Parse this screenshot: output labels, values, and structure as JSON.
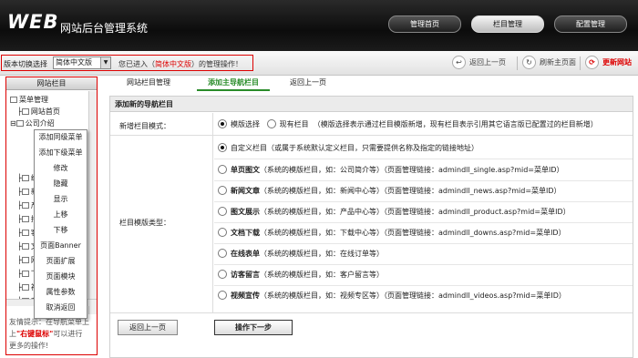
{
  "header": {
    "logo_web": "WEB",
    "logo_title": "网站后台管理系统",
    "nav": [
      {
        "label": "管理首页",
        "active": false
      },
      {
        "label": "栏目管理",
        "active": true
      },
      {
        "label": "配置管理",
        "active": false
      }
    ]
  },
  "toolbar": {
    "version_label": "版本切换选择",
    "version_selected": "简体中文版",
    "message_prefix": "您已进入（",
    "message_highlight": "简体中文版",
    "message_suffix": "）的管理操作！",
    "back_label": "返回上一页",
    "refresh_label": "刷新主页面",
    "update_label": "更新网站"
  },
  "sidebar": {
    "title": "网站栏目",
    "tree": [
      {
        "label": "菜单管理"
      },
      {
        "label": "网站首页"
      },
      {
        "label": "公司介绍"
      },
      {
        "label": "经"
      },
      {
        "label": "新"
      },
      {
        "label": "产"
      },
      {
        "label": "招"
      },
      {
        "label": "客"
      },
      {
        "label": "文"
      },
      {
        "label": "网"
      },
      {
        "label": "下"
      },
      {
        "label": "视"
      },
      {
        "label": "在"
      }
    ],
    "tip_line1": "友情提示：在导航菜单上",
    "tip_line2_pre": "上",
    "tip_highlight": "\"右键鼠标\"",
    "tip_line2_post": "可以进行",
    "tip_line3": "更多的操作!"
  },
  "context_menu": {
    "items": [
      "添加同级菜单",
      "添加下级菜单",
      "修改",
      "隐藏",
      "显示",
      "上移",
      "下移",
      "页面Banner",
      "页面扩展",
      "页面模块",
      "属性参数",
      "取消返回"
    ]
  },
  "main": {
    "tabs": [
      {
        "label": "网站栏目管理",
        "active": false
      },
      {
        "label": "添加主导航栏目",
        "active": true
      },
      {
        "label": "返回上一页",
        "active": false
      }
    ],
    "panel_title": "添加新的导航栏目",
    "mode_label": "新增栏目模式：",
    "mode_options": [
      {
        "label": "模版选择",
        "checked": true
      },
      {
        "label": "现有栏目",
        "checked": false
      }
    ],
    "mode_hint": "（模版选择表示通过栏目模版新增，现有栏目表示引用其它语言版已配置过的栏目新增）",
    "type_label": "栏目模版类型：",
    "types": [
      {
        "name": "自定义栏目",
        "bold": false,
        "desc": "（或属于系统默认定义栏目，只需要提供名称及指定的链接地址）",
        "checked": true
      },
      {
        "name": "单页图文",
        "bold": true,
        "desc": "（系统的模版栏目，如：公司简介等）（页面管理链接：admindll_single.asp?mid=菜单ID）",
        "checked": false
      },
      {
        "name": "新闻文章",
        "bold": true,
        "desc": "（系统的模版栏目，如：新闻中心等）（页面管理链接：admindll_news.asp?mid=菜单ID）",
        "checked": false
      },
      {
        "name": "图文展示",
        "bold": true,
        "desc": "（系统的模版栏目，如：产品中心等）（页面管理链接：admindll_product.asp?mid=菜单ID）",
        "checked": false
      },
      {
        "name": "文档下载",
        "bold": true,
        "desc": "（系统的模版栏目，如：下载中心等）（页面管理链接：admindll_downs.asp?mid=菜单ID）",
        "checked": false
      },
      {
        "name": "在线表单",
        "bold": true,
        "desc": "（系统的模版栏目，如：在线订单等）",
        "checked": false
      },
      {
        "name": "访客留言",
        "bold": true,
        "desc": "（系统的模版栏目，如：客户留言等）",
        "checked": false
      },
      {
        "name": "视频宣传",
        "bold": true,
        "desc": "（系统的模版栏目，如：视频专区等）（页面管理链接：admindll_videos.asp?mid=菜单ID）",
        "checked": false
      }
    ],
    "back_button": "返回上一页",
    "next_button": "操作下一步"
  }
}
